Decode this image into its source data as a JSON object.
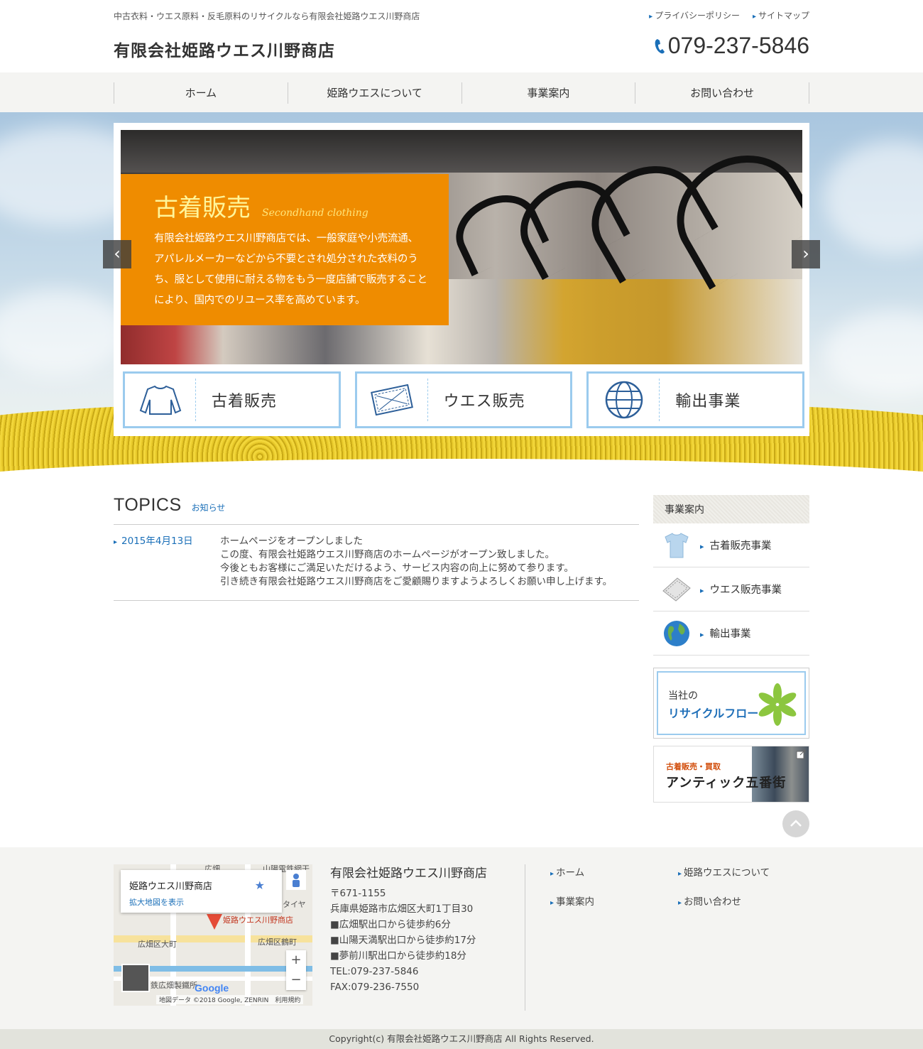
{
  "header": {
    "tagline": "中古衣料・ウエス原料・反毛原料のリサイクルなら有限会社姫路ウエス川野商店",
    "links": [
      "プライバシーポリシー",
      "サイトマップ"
    ],
    "site_name": "有限会社姫路ウエス川野商店",
    "phone": "079-237-5846"
  },
  "nav": [
    "ホーム",
    "姫路ウエスについて",
    "事業案内",
    "お問い合わせ"
  ],
  "hero": {
    "title": "古着販売",
    "subtitle_en": "Secondhand clothing",
    "text_lines": [
      "有限会社姫路ウエス川野商店では、一般家庭や小売流通、",
      "アパレルメーカーなどから不要とされ処分された衣料のう",
      "ち、服として使用に耐える物をもう一度店舗で販売すること",
      "により、国内でのリユース率を高めています。"
    ],
    "cards": [
      "古着販売",
      "ウエス販売",
      "輸出事業"
    ]
  },
  "topics": {
    "title": "TOPICS",
    "subtitle": "お知らせ",
    "items": [
      {
        "date": "2015年4月13日",
        "lines": [
          "ホームページをオープンしました",
          "この度、有限会社姫路ウエス川野商店のホームページがオープン致しました。",
          "今後ともお客様にご満足いただけるよう、サービス内容の向上に努めて参ります。",
          "引き続き有限会社姫路ウエス川野商店をご愛顧賜りますようよろしくお願い申し上げます。"
        ]
      }
    ]
  },
  "sidebar": {
    "heading": "事業案内",
    "menu": [
      "古着販売事業",
      "ウエス販売事業",
      "輸出事業"
    ],
    "banner1": {
      "small": "当社の",
      "big": "リサイクルフロー"
    },
    "banner2": {
      "small": "古着販売・買取",
      "big": "アンティック五番街"
    }
  },
  "footer": {
    "map": {
      "place": "姫路ウエス川野商店",
      "link": "拡大地図を表示",
      "labels": [
        "山陽電鉄網干",
        "タイヤ",
        "姫路ウエス川野商店",
        "広畑区大町",
        "広畑区鶴町",
        "鉄広畑製鐵所",
        "広畑"
      ],
      "attribution": "地図データ ©2018 Google, ZENRIN",
      "terms": "利用規約",
      "logo": "Google"
    },
    "company": "有限会社姫路ウエス川野商店",
    "address_lines": [
      "〒671-1155",
      "兵庫県姫路市広畑区大町1丁目30",
      "■広畑駅出口から徒歩約6分",
      "■山陽天満駅出口から徒歩約17分",
      "■夢前川駅出口から徒歩約18分",
      "TEL:079-237-5846",
      "FAX:079-236-7550"
    ],
    "nav": [
      "ホーム",
      "姫路ウエスについて",
      "事業案内",
      "お問い合わせ"
    ]
  },
  "copyright": "Copyright(c) 有限会社姫路ウエス川野商店 All Rights Reserved.",
  "colors": {
    "accent_blue": "#1a6fb8",
    "caption_orange": "#ef8c00",
    "card_border": "#9bcbee"
  }
}
